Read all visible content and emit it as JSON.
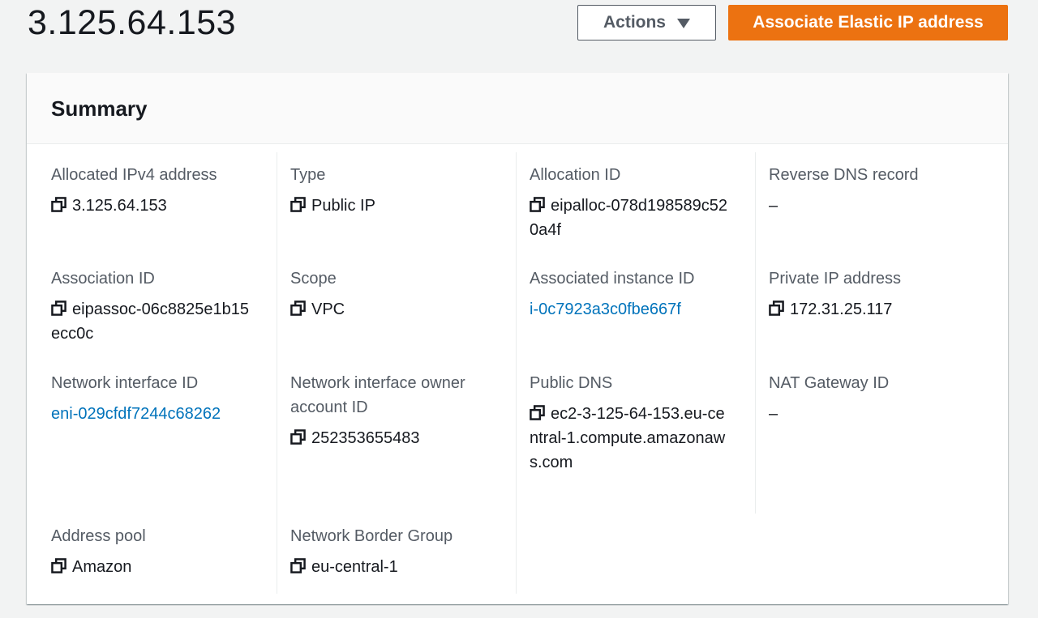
{
  "page": {
    "title": "3.125.64.153"
  },
  "header": {
    "actions_label": "Actions",
    "primary_label": "Associate Elastic IP address"
  },
  "summary": {
    "title": "Summary",
    "allocated_ipv4": {
      "label": "Allocated IPv4 address",
      "value": "3.125.64.153"
    },
    "type": {
      "label": "Type",
      "value": "Public IP"
    },
    "allocation_id": {
      "label": "Allocation ID",
      "value": "eipalloc-078d198589c520a4f"
    },
    "reverse_dns": {
      "label": "Reverse DNS record",
      "value": "–"
    },
    "association_id": {
      "label": "Association ID",
      "value": "eipassoc-06c8825e1b15ecc0c"
    },
    "scope": {
      "label": "Scope",
      "value": "VPC"
    },
    "associated_instance": {
      "label": "Associated instance ID",
      "value": "i-0c7923a3c0fbe667f"
    },
    "private_ip": {
      "label": "Private IP address",
      "value": "172.31.25.117"
    },
    "network_interface": {
      "label": "Network interface ID",
      "value": "eni-029cfdf7244c68262"
    },
    "interface_owner": {
      "label": "Network interface owner account ID",
      "value": "252353655483"
    },
    "public_dns": {
      "label": "Public DNS",
      "value": "ec2-3-125-64-153.eu-central-1.compute.amazonaws.com"
    },
    "nat_gateway": {
      "label": "NAT Gateway ID",
      "value": "–"
    },
    "address_pool": {
      "label": "Address pool",
      "value": "Amazon"
    },
    "border_group": {
      "label": "Network Border Group",
      "value": "eu-central-1"
    }
  },
  "colors": {
    "accent": "#ec7211",
    "link": "#0073bb",
    "label": "#545b64"
  },
  "icons": {
    "copy": "copy-icon",
    "dropdown": "caret-down-icon"
  }
}
